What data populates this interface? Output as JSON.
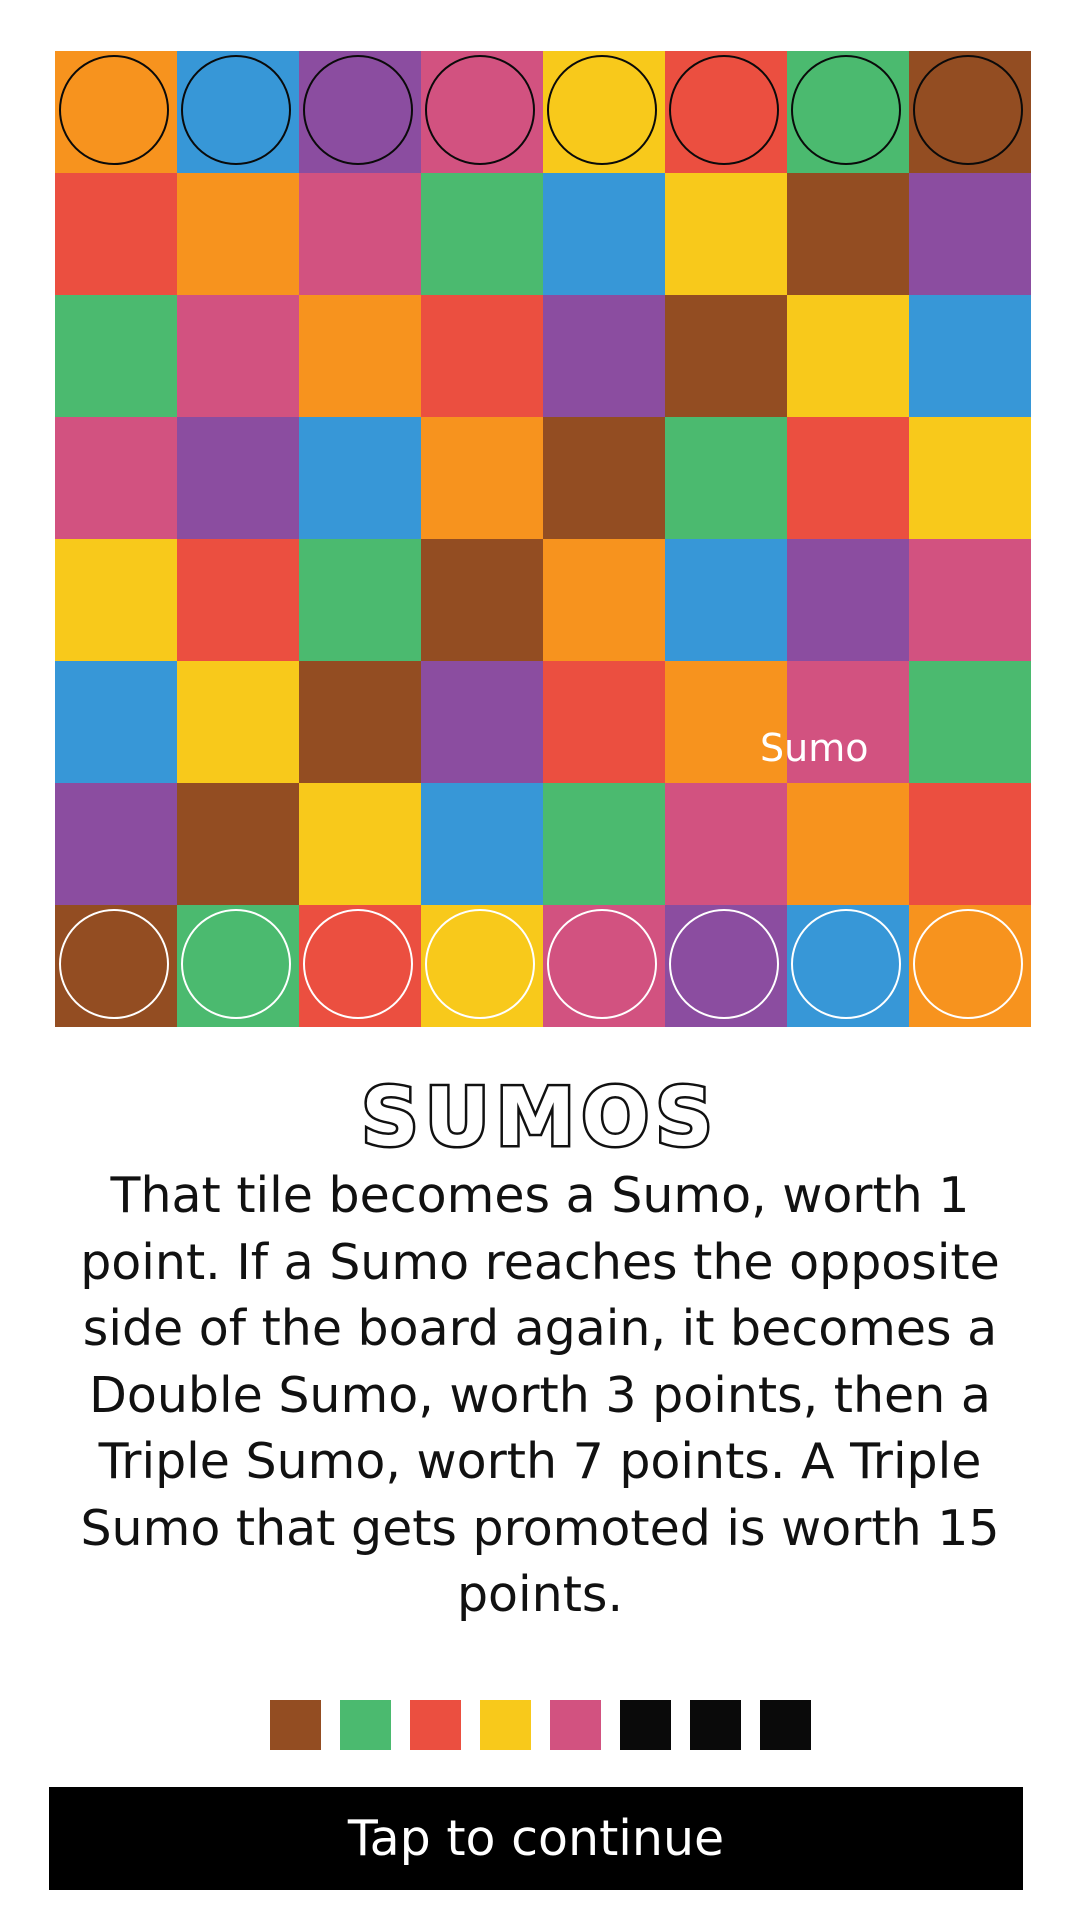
{
  "colors": {
    "orange": "#F7931E",
    "blue": "#3797D7",
    "purple": "#8B4DA0",
    "pink": "#D25280",
    "yellow": "#F8C91B",
    "red": "#EB4F40",
    "green": "#4BBA6F",
    "brown": "#934D22",
    "black": "#0A0A0A",
    "white": "#FFFFFF"
  },
  "board": {
    "rows": [
      [
        "orange",
        "blue",
        "purple",
        "pink",
        "yellow",
        "red",
        "green",
        "brown"
      ],
      [
        "red",
        "orange",
        "pink",
        "green",
        "blue",
        "yellow",
        "brown",
        "purple"
      ],
      [
        "green",
        "pink",
        "orange",
        "red",
        "purple",
        "brown",
        "yellow",
        "blue"
      ],
      [
        "pink",
        "purple",
        "blue",
        "orange",
        "brown",
        "green",
        "red",
        "yellow"
      ],
      [
        "yellow",
        "red",
        "green",
        "brown",
        "orange",
        "blue",
        "purple",
        "pink"
      ],
      [
        "blue",
        "yellow",
        "brown",
        "purple",
        "red",
        "orange",
        "pink",
        "green"
      ],
      [
        "purple",
        "brown",
        "yellow",
        "blue",
        "green",
        "pink",
        "orange",
        "red"
      ],
      [
        "brown",
        "green",
        "red",
        "yellow",
        "pink",
        "purple",
        "blue",
        "orange"
      ]
    ],
    "pieces": {
      "top_row": {
        "row": 0,
        "player": "black",
        "ring_color": "black"
      },
      "bottom_row": {
        "row": 7,
        "player": "white",
        "ring_color": "white"
      }
    },
    "label": {
      "text": "Sumo",
      "row": 5,
      "col": 6
    }
  },
  "title": "SUMOS",
  "body_text": "That tile becomes a Sumo, worth 1 point. If a Sumo reaches the opposite side of the board again, it becomes a Double Sumo, worth 3 points, then a Triple Sumo, worth 7 points. A Triple Sumo that gets promoted is worth 15 points.",
  "progress_swatches": [
    "brown",
    "green",
    "red",
    "yellow",
    "pink",
    "black",
    "black",
    "black"
  ],
  "continue_button_label": "Tap to continue"
}
